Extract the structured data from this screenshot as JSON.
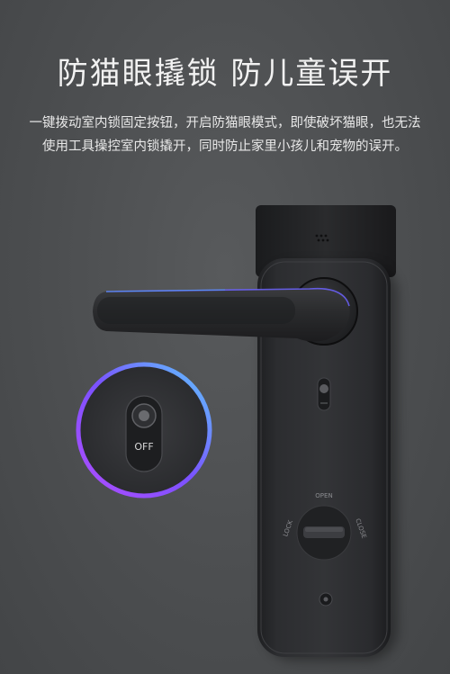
{
  "title": "防猫眼撬锁  防儿童误开",
  "description": {
    "line1": "一键拨动室内锁固定按钮，开启防猫眼模式，即使破坏猫眼，也无法",
    "line2": "使用工具操控室内锁撬开，同时防止家里小孩儿和宠物的误开。"
  },
  "detail_switch_label": "OFF",
  "knob_labels": {
    "top": "OPEN",
    "left": "LOCK",
    "right": "CLOSE"
  },
  "colors": {
    "ring_gradient": [
      "#5ec8ff",
      "#7a52ff",
      "#b04cff"
    ],
    "body": "#2b2c2e",
    "background": "#4c4e50"
  }
}
